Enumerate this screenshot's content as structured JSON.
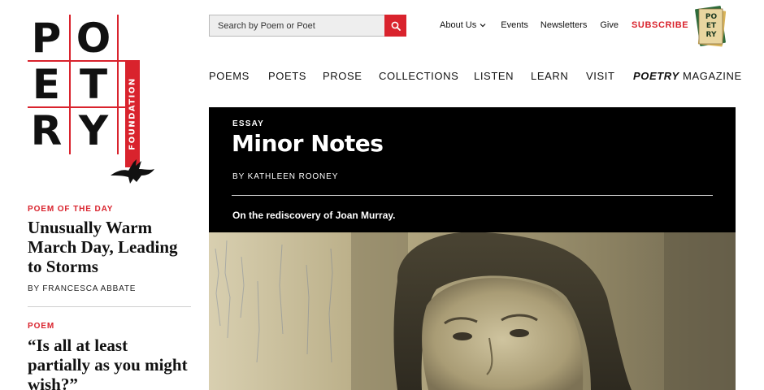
{
  "logo": {
    "letters": [
      "P",
      "O",
      "E",
      "T",
      "R",
      "Y"
    ],
    "foundation_label": "FOUNDATION",
    "accent": "#d9232d"
  },
  "search": {
    "placeholder": "Search by Poem or Poet",
    "icon": "search-icon"
  },
  "utility_nav": {
    "about": "About Us",
    "events": "Events",
    "newsletters": "Newsletters",
    "give": "Give",
    "subscribe": "SUBSCRIBE",
    "about_icon": "chevron-down-icon"
  },
  "magazine_badge": {
    "lines": [
      "PO",
      "ET",
      "RY"
    ]
  },
  "main_nav": {
    "poems": "POEMS",
    "poets": "POETS",
    "prose": "PROSE",
    "collections": "COLLECTIONS",
    "listen": "LISTEN",
    "learn": "LEARN",
    "visit": "VISIT",
    "magazine_bold": "POETRY",
    "magazine_rest": " MAGAZINE"
  },
  "sidebar": {
    "items": [
      {
        "kicker": "POEM OF THE DAY",
        "title": "Unusually Warm March Day, Leading to Storms",
        "byline": "BY FRANCESCA ABBATE"
      },
      {
        "kicker": "POEM",
        "title": "“Is all at least partially as you might wish?”"
      }
    ]
  },
  "essay": {
    "kicker": "ESSAY",
    "title": "Minor Notes",
    "byline": "BY KATHLEEN ROONEY",
    "dek": "On the rediscovery of Joan Murray."
  },
  "colors": {
    "accent": "#d9232d",
    "hero_bg": "#000000",
    "photo_tone": "#b5a880"
  }
}
